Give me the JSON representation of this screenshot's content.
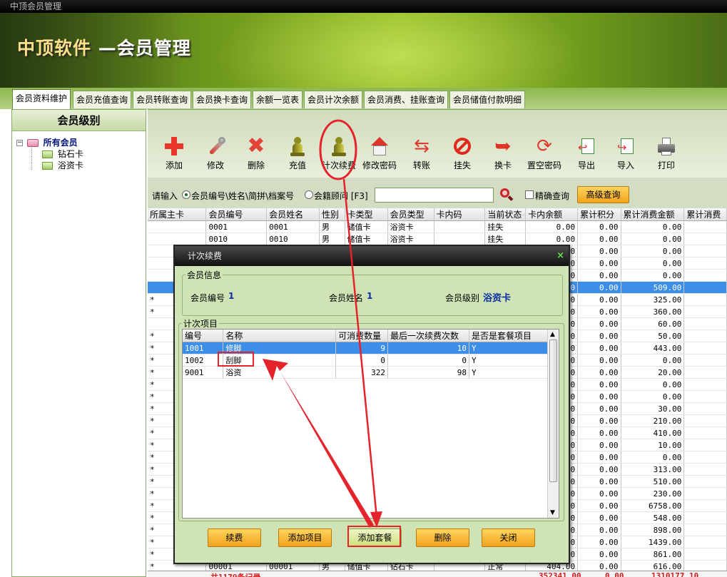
{
  "window_title": "中顶会员管理",
  "app_title": {
    "brand": "中顶软件",
    "name": "—会员管理"
  },
  "tabs": [
    "会员资料维护",
    "会员充值查询",
    "会员转账查询",
    "会员换卡查询",
    "余额一览表",
    "会员计次余额",
    "会员消费、挂账查询",
    "会员储值付款明细"
  ],
  "left_panel": {
    "header": "会员级别",
    "tree": {
      "root": "所有会员",
      "children": [
        "钻石卡",
        "浴资卡"
      ]
    }
  },
  "toolbar": [
    "添加",
    "修改",
    "删除",
    "充值",
    "计次续费",
    "修改密码",
    "转账",
    "挂失",
    "换卡",
    "置空密码",
    "导出",
    "导入",
    "打印"
  ],
  "search": {
    "label": "请输入",
    "opt1": "会员编号\\姓名\\简拼\\档案号",
    "opt2": "会籍顾问 [F3]",
    "value": "",
    "exact": "精确查询",
    "advanced": "高级查询"
  },
  "grid": {
    "columns": [
      "所属主卡",
      "会员编号",
      "会员姓名",
      "性别",
      "卡类型",
      "会员类型",
      "卡内码",
      "当前状态",
      "卡内余额",
      "累计积分",
      "累计消费金额",
      "累计消费"
    ],
    "rows": [
      [
        "",
        "0001",
        "0001",
        "男",
        "储值卡",
        "浴资卡",
        "",
        "挂失",
        "0.00",
        "0.00",
        "0.00"
      ],
      [
        "",
        "0010",
        "0010",
        "男",
        "储值卡",
        "浴资卡",
        "",
        "挂失",
        "0.00",
        "0.00",
        "0.00"
      ],
      [
        "",
        "",
        "",
        "",
        "",
        "",
        "",
        "",
        "0.00",
        "0.00",
        "0.00"
      ],
      [
        "",
        "",
        "",
        "",
        "",
        "",
        "",
        "",
        "0.00",
        "0.00",
        "0.00"
      ],
      [
        "",
        "",
        "",
        "",
        "",
        "",
        "",
        "",
        "0.00",
        "0.00",
        "0.00"
      ],
      [
        "",
        "",
        "",
        "",
        "",
        "",
        "",
        "",
        "0.00",
        "0.00",
        "509.00"
      ],
      [
        "*",
        "",
        "",
        "",
        "",
        "",
        "",
        "",
        "0.00",
        "0.00",
        "325.00"
      ],
      [
        "*",
        "",
        "",
        "",
        "",
        "",
        "",
        "",
        "0.00",
        "0.00",
        "360.00"
      ],
      [
        "",
        "",
        "",
        "",
        "",
        "",
        "",
        "",
        "0.00",
        "0.00",
        "60.00"
      ],
      [
        "*",
        "",
        "",
        "",
        "",
        "",
        "",
        "",
        "0.00",
        "0.00",
        "50.00"
      ],
      [
        "*",
        "",
        "",
        "",
        "",
        "",
        "",
        "",
        "0.00",
        "0.00",
        "443.00"
      ],
      [
        "*",
        "",
        "",
        "",
        "",
        "",
        "",
        "",
        "0.00",
        "0.00",
        "0.00"
      ],
      [
        "*",
        "",
        "",
        "",
        "",
        "",
        "",
        "",
        "0.00",
        "0.00",
        "20.00"
      ],
      [
        "*",
        "",
        "",
        "",
        "",
        "",
        "",
        "",
        "0.00",
        "0.00",
        "0.00"
      ],
      [
        "*",
        "",
        "",
        "",
        "",
        "",
        "",
        "",
        "0.00",
        "0.00",
        "0.00"
      ],
      [
        "*",
        "",
        "",
        "",
        "",
        "",
        "",
        "",
        "0.00",
        "0.00",
        "30.00"
      ],
      [
        "*",
        "",
        "",
        "",
        "",
        "",
        "",
        "",
        "0.00",
        "0.00",
        "210.00"
      ],
      [
        "*",
        "",
        "",
        "",
        "",
        "",
        "",
        "",
        "0.00",
        "0.00",
        "410.00"
      ],
      [
        "*",
        "",
        "",
        "",
        "",
        "",
        "",
        "",
        "0.00",
        "0.00",
        "10.00"
      ],
      [
        "*",
        "",
        "",
        "",
        "",
        "",
        "",
        "",
        "0.00",
        "0.00",
        "0.00"
      ],
      [
        "*",
        "",
        "",
        "",
        "",
        "",
        "",
        "",
        "0.00",
        "0.00",
        "313.00"
      ],
      [
        "*",
        "",
        "",
        "",
        "",
        "",
        "",
        "",
        "0.00",
        "0.00",
        "510.00"
      ],
      [
        "*",
        "",
        "",
        "",
        "",
        "",
        "",
        "",
        "0.00",
        "0.00",
        "230.00"
      ],
      [
        "*",
        "",
        "",
        "",
        "",
        "",
        "",
        "",
        "0.00",
        "0.00",
        "6758.00"
      ],
      [
        "*",
        "",
        "",
        "",
        "",
        "",
        "",
        "",
        "2.00",
        "0.00",
        "548.00"
      ],
      [
        "*",
        "",
        "",
        "",
        "",
        "",
        "",
        "",
        "2.00",
        "0.00",
        "898.00"
      ],
      [
        "*",
        "",
        "",
        "",
        "",
        "",
        "",
        "",
        "6.00",
        "0.00",
        "1439.00"
      ],
      [
        "*",
        "",
        "",
        "",
        "",
        "",
        "",
        "",
        "9.00",
        "0.00",
        "861.00"
      ],
      [
        "*",
        "00001",
        "00001",
        "男",
        "储值卡",
        "钻石卡",
        "",
        "正常",
        "404.00",
        "0.00",
        "616.00"
      ]
    ],
    "footer": {
      "count": "共1179条记录",
      "balance": "352341.00",
      "points": "0.00",
      "consume": "1310177.10"
    }
  },
  "dialog": {
    "title": "计次续费",
    "member_info_legend": "会员信息",
    "member_no_label": "会员编号",
    "member_no": "1",
    "member_name_label": "会员姓名",
    "member_name": "1",
    "member_level_label": "会员级别",
    "member_level": "浴资卡",
    "items_legend": "计次项目",
    "columns": [
      "编号",
      "名称",
      "可消费数量",
      "最后一次续费次数",
      "是否是套餐项目"
    ],
    "rows": [
      [
        "1001",
        "修脚",
        "9",
        "10",
        "Y"
      ],
      [
        "1002",
        "刮脚",
        "0",
        "0",
        "Y"
      ],
      [
        "9001",
        "浴资",
        "322",
        "98",
        "Y"
      ]
    ],
    "buttons": [
      "续费",
      "添加项目",
      "添加套餐",
      "删除",
      "关闭"
    ]
  },
  "colors": {
    "accent_green": "#8fb922",
    "selected_row": "#3d8ee8",
    "annotation_red": "#e5232b",
    "button_orange": "#f0a21c"
  }
}
